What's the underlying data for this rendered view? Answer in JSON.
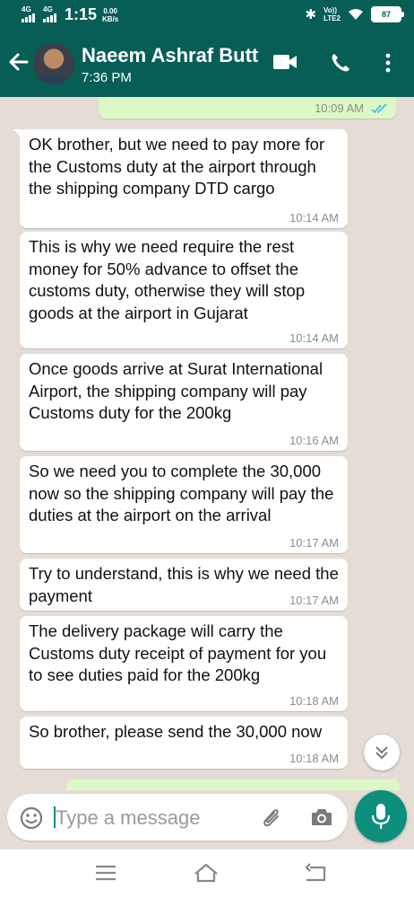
{
  "status_bar": {
    "sim1_label": "4G",
    "sim2_label": "4G",
    "time": "1:15",
    "speed_value": "0.00",
    "speed_unit": "KB/s",
    "volte_line1": "Vo))",
    "volte_line2": "LTE2",
    "battery": "87"
  },
  "header": {
    "contact_name": "Naeem Ashraf Butt",
    "last_seen": "7:36 PM",
    "icons": [
      "back-arrow-icon",
      "video-call-icon",
      "phone-call-icon",
      "more-options-icon"
    ]
  },
  "messages": [
    {
      "direction": "out",
      "text": "",
      "time": "10:09 AM",
      "status": "read"
    },
    {
      "direction": "in",
      "text": "OK brother, but we need to pay more for the Customs duty at the airport through the shipping company DTD cargo",
      "time": "10:14 AM"
    },
    {
      "direction": "in",
      "text": "This is why we need require the rest money for 50% advance to offset the customs duty, otherwise they will stop goods at the airport in Gujarat",
      "time": "10:14 AM"
    },
    {
      "direction": "in",
      "text": "Once goods arrive at Surat International Airport, the shipping company will pay Customs duty for the 200kg",
      "time": "10:16 AM"
    },
    {
      "direction": "in",
      "text": "So we need you to complete the 30,000 now so the shipping company will pay the duties at the airport on the arrival",
      "time": "10:17 AM"
    },
    {
      "direction": "in",
      "text": "Try to understand, this is why we need the payment",
      "time": "10:17 AM"
    },
    {
      "direction": "in",
      "text": "The delivery package will carry the Customs duty receipt of payment for you to see duties paid for the 200kg",
      "time": "10:18 AM"
    },
    {
      "direction": "in",
      "text": "So brother, please send the 30,000 now",
      "time": "10:18 AM"
    }
  ],
  "composer": {
    "placeholder": "Type a message"
  },
  "colors": {
    "header": "#075e54",
    "chat_background": "#e5ddd5",
    "incoming_bubble": "#ffffff",
    "outgoing_bubble": "#dcf8c6",
    "accent": "#0d8f7c",
    "read_ticks": "#34b7f1"
  }
}
